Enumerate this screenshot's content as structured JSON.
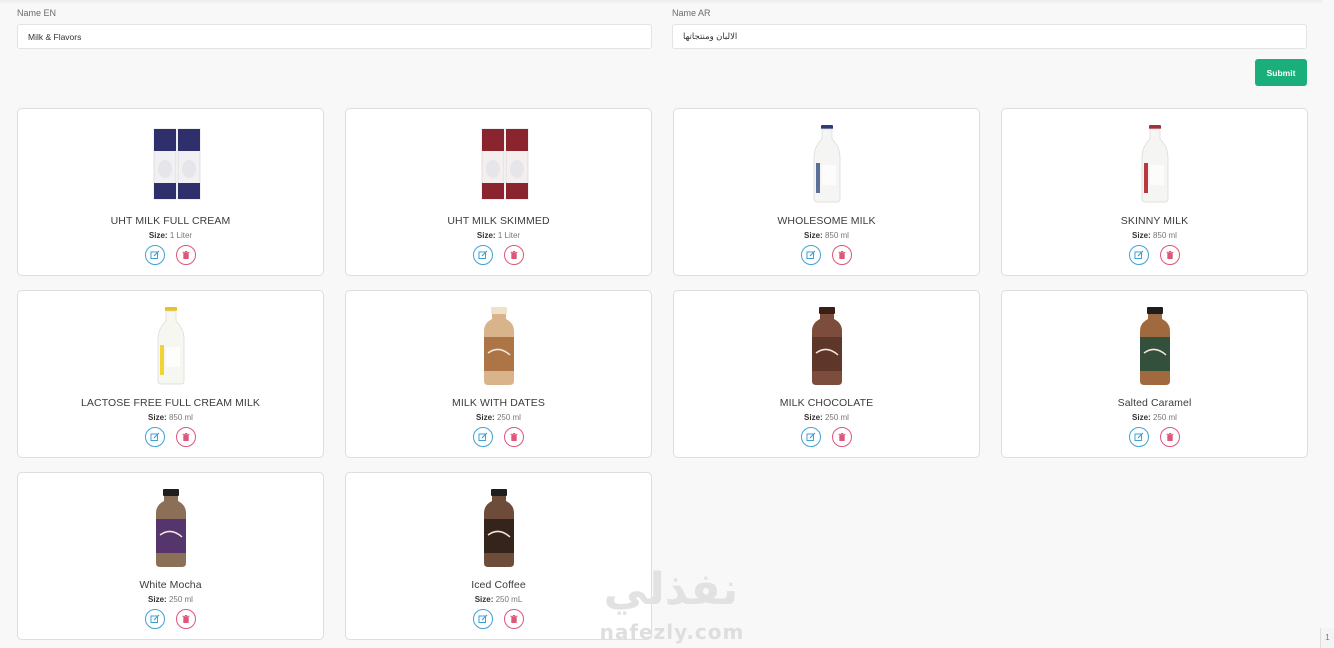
{
  "form": {
    "name_en_label": "Name EN",
    "name_en_value": "Milk & Flavors",
    "name_ar_label": "Name AR",
    "name_ar_value": "الالبان ومنتجاتها",
    "submit_label": "Submit"
  },
  "size_label": "Size:",
  "products": [
    {
      "name": "UHT MILK FULL CREAM",
      "size": "1 Liter",
      "type": "carton",
      "colors": {
        "body": "#f1f1f4",
        "label": "#2e2f6b",
        "cap": "#2e2f6b"
      }
    },
    {
      "name": "UHT MILK SKIMMED",
      "size": "1 Liter",
      "type": "carton",
      "colors": {
        "body": "#f4eeee",
        "label": "#8a2530",
        "cap": "#8a2530"
      }
    },
    {
      "name": "WHOLESOME MILK",
      "size": "850 ml",
      "type": "glass",
      "colors": {
        "body": "#f5f5f3",
        "label": "#5b6f97",
        "cap": "#2e3b78"
      }
    },
    {
      "name": "SKINNY MILK",
      "size": "850 ml",
      "type": "glass",
      "colors": {
        "body": "#f5f5f3",
        "label": "#b9393f",
        "cap": "#a3323a"
      }
    },
    {
      "name": "LACTOSE FREE FULL CREAM MILK",
      "size": "850 ml",
      "type": "glass",
      "colors": {
        "body": "#f7f7f2",
        "label": "#f0d433",
        "cap": "#e8c41a"
      }
    },
    {
      "name": "MILK WITH DATES",
      "size": "250 ml",
      "type": "small",
      "colors": {
        "body": "#d9b48b",
        "label": "#a4683a",
        "cap": "#f0e1c9"
      }
    },
    {
      "name": "MILK CHOCOLATE",
      "size": "250 ml",
      "type": "small",
      "colors": {
        "body": "#7c4d3c",
        "label": "#5b3427",
        "cap": "#3b1e14"
      }
    },
    {
      "name": "Salted Caramel",
      "size": "250 ml",
      "type": "small",
      "colors": {
        "body": "#a06a3e",
        "label": "#1f4b3c",
        "cap": "#1d1d1d"
      }
    },
    {
      "name": "White Mocha",
      "size": "250 ml",
      "type": "small",
      "colors": {
        "body": "#8c6f57",
        "label": "#4b2b6e",
        "cap": "#1e1e1e"
      }
    },
    {
      "name": "Iced Coffee",
      "size": "250 mL",
      "type": "small",
      "colors": {
        "body": "#6e4c3a",
        "label": "#2c1d16",
        "cap": "#1e1e1e"
      }
    }
  ],
  "watermark": {
    "arabic": "نفذلي",
    "latin": "nafezly.com"
  },
  "scroll_corner": "1"
}
